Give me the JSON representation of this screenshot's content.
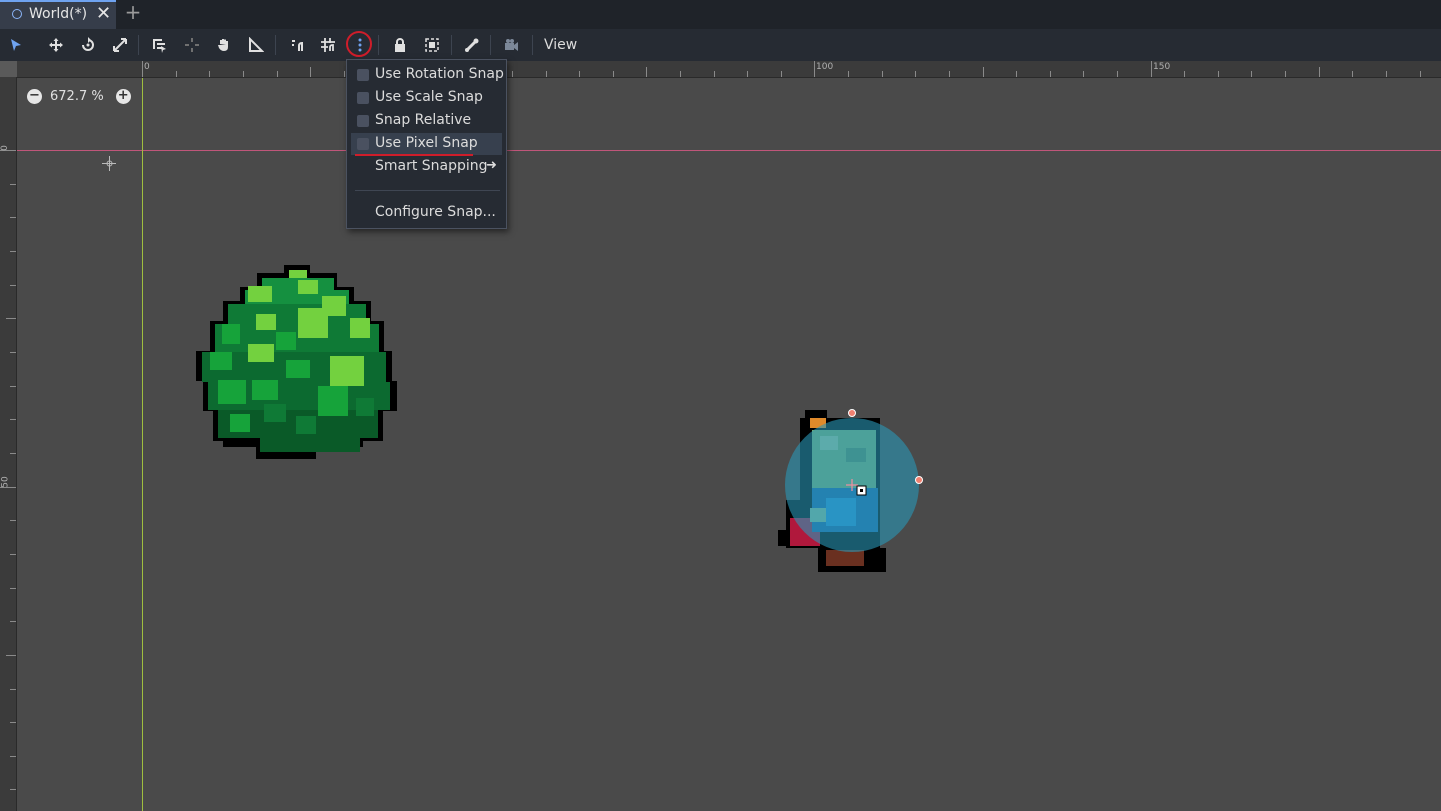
{
  "tab": {
    "title": "World(*)",
    "close": "✕",
    "add": "+"
  },
  "toolbar": {
    "tools": [
      "select-icon",
      "move-icon",
      "rotate-icon",
      "scale-icon",
      "list-select-icon",
      "pivot-icon",
      "pan-icon",
      "ruler-icon",
      "smart-snap-icon",
      "grid-snap-icon",
      "more-icon",
      "lock-icon",
      "group-icon",
      "skeleton-icon",
      "camera-icon"
    ],
    "view_label": "View"
  },
  "zoom": {
    "minus": "−",
    "plus": "+",
    "value": "672.7 %"
  },
  "ruler": {
    "top_labels": [
      "0",
      "100",
      "150"
    ],
    "left_labels": [
      "0",
      "50"
    ]
  },
  "snap_menu": {
    "items": [
      {
        "label": "Use Rotation Snap",
        "checked": false
      },
      {
        "label": "Use Scale Snap",
        "checked": false
      },
      {
        "label": "Snap Relative",
        "checked": false
      },
      {
        "label": "Use Pixel Snap",
        "checked": false
      },
      {
        "label": "Smart Snapping",
        "submenu": true
      }
    ],
    "configure": "Configure Snap...",
    "arrow": "➜"
  },
  "colors": {
    "accent": "#6fa3f0",
    "highlight_ring": "#cf1d2a",
    "origin_h": "#c0567a",
    "origin_v": "#9fbf3f",
    "collision": "#2a98b8"
  }
}
